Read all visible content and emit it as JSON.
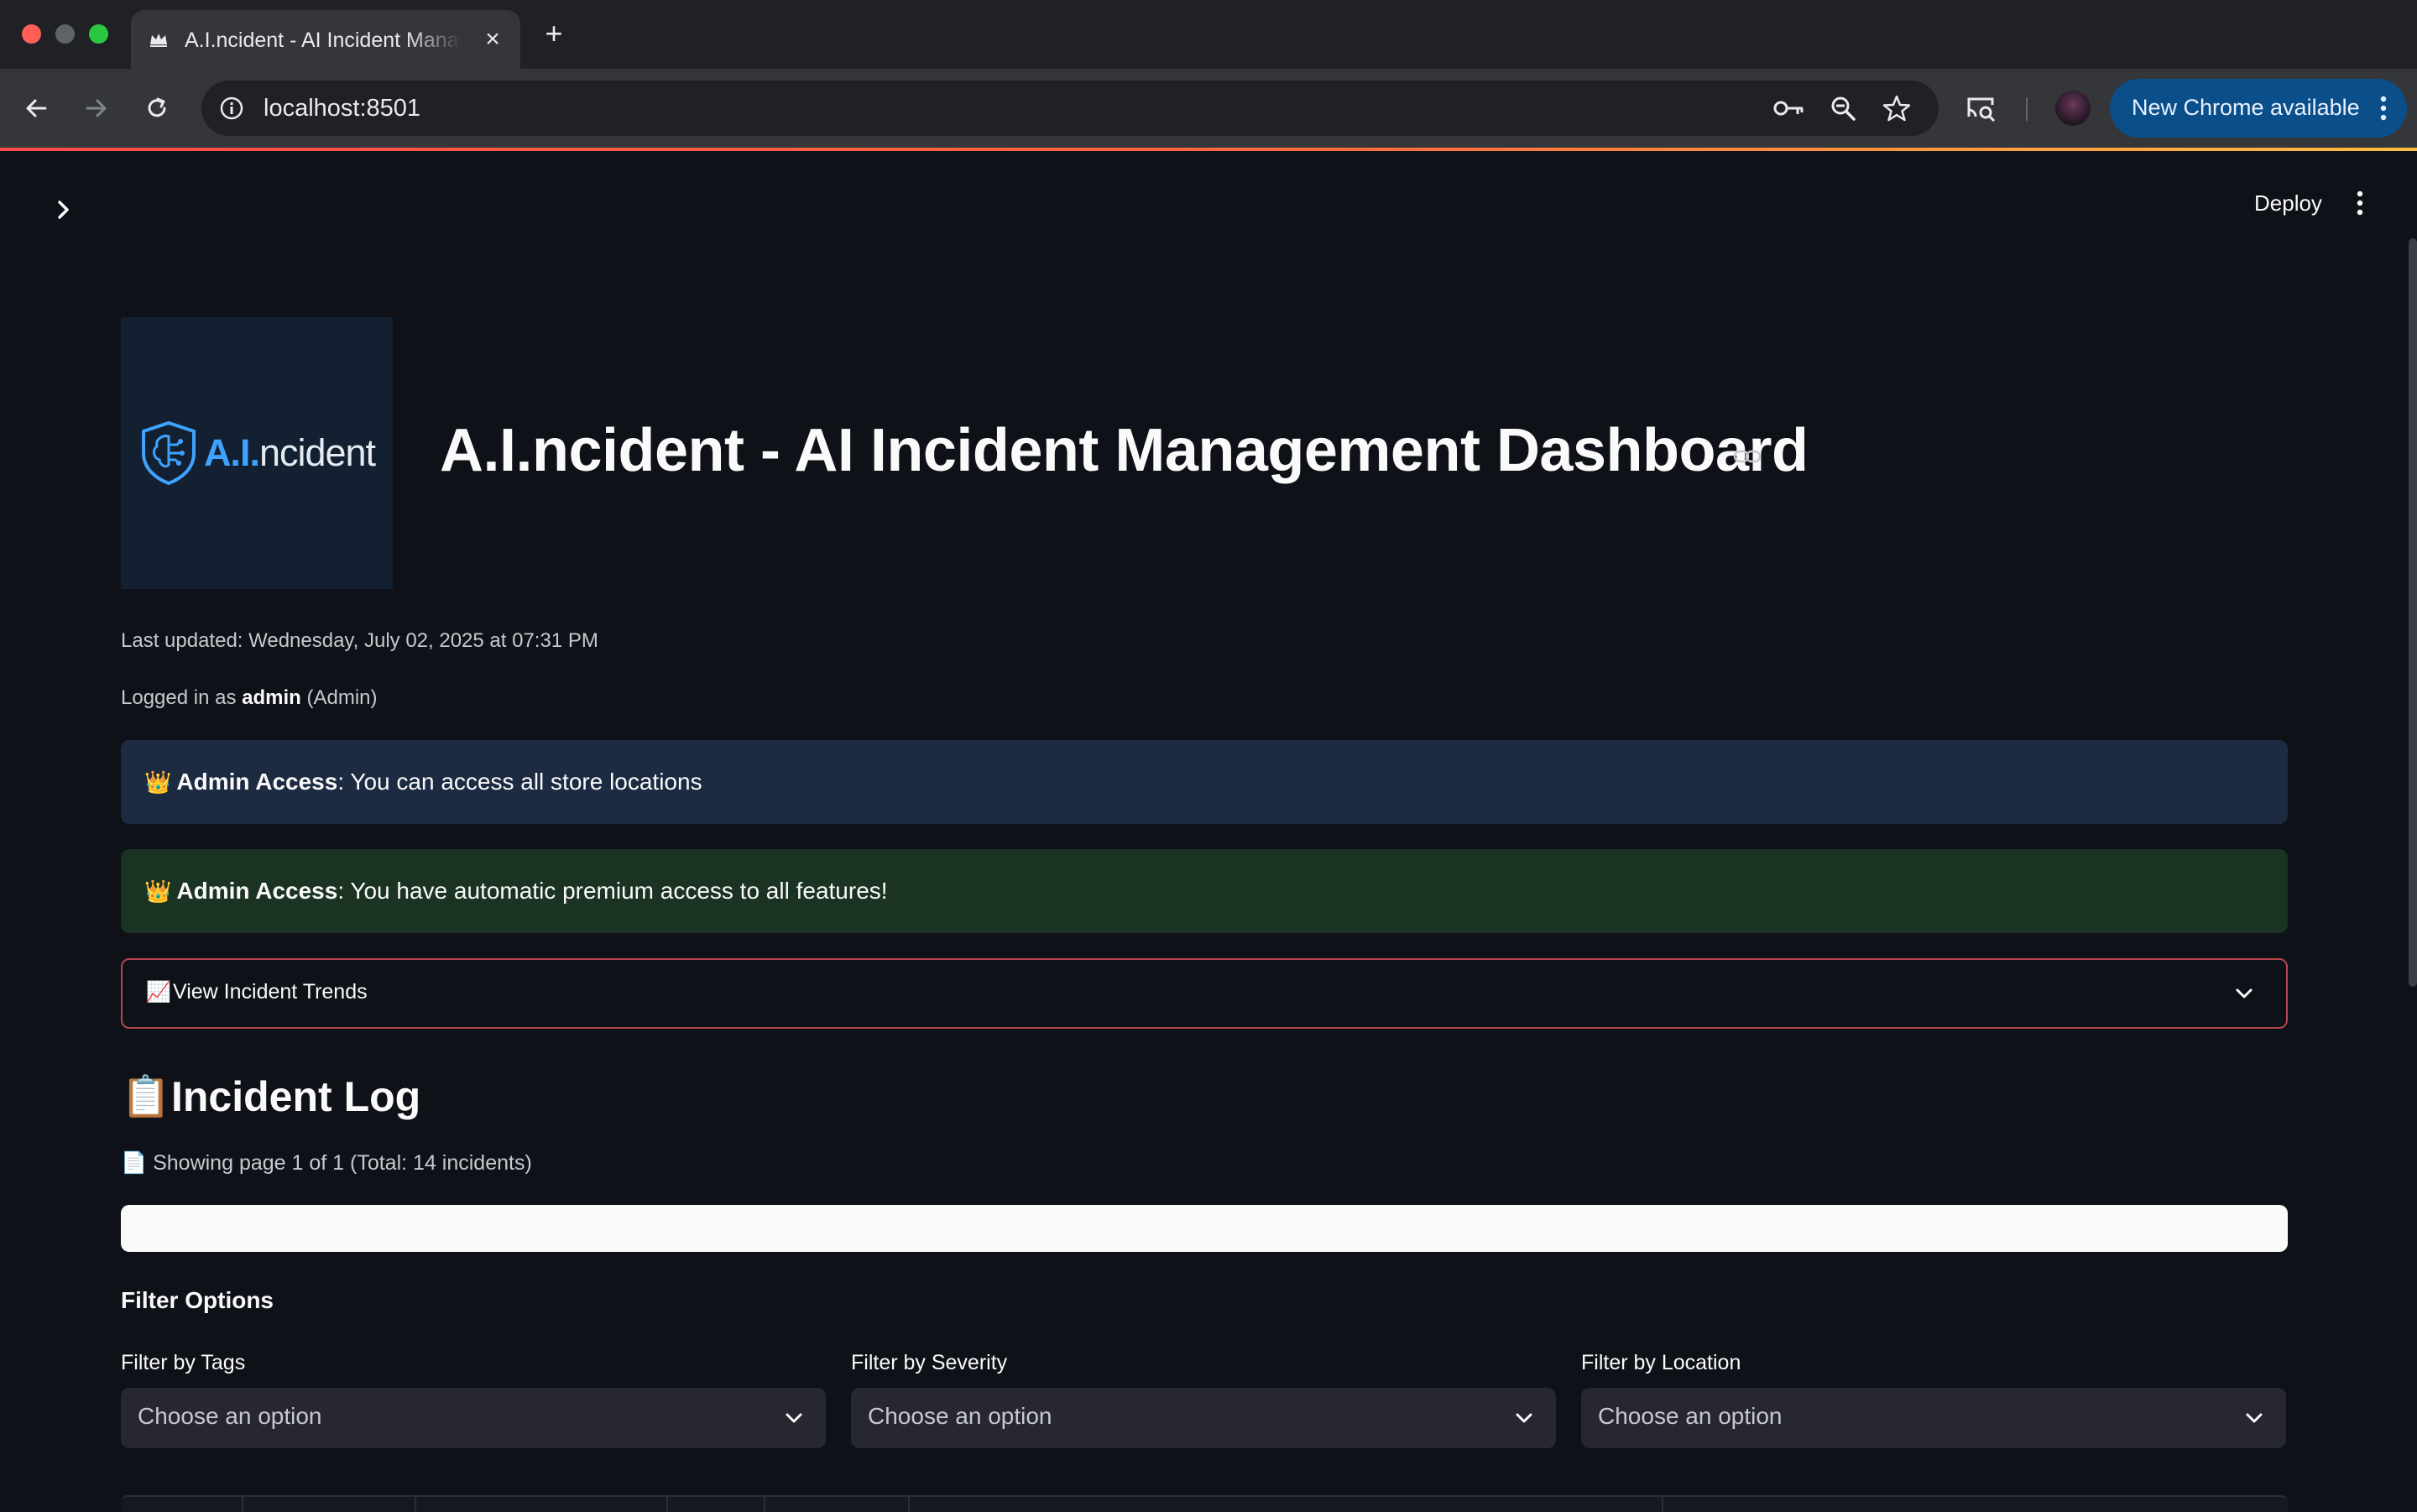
{
  "browser": {
    "tab_title": "A.I.ncident - AI Incident Management Dashboard",
    "tab_close": "×",
    "new_tab": "+",
    "url": "localhost:8501",
    "update_label": "New Chrome available"
  },
  "header": {
    "deploy_label": "Deploy"
  },
  "logo": {
    "prefix": "A.I.",
    "suffix": "ncident"
  },
  "page": {
    "title": "A.I.ncident - AI Incident Management Dashboard",
    "last_updated": "Last updated: Wednesday, July 02, 2025 at 07:31 PM",
    "logged_in_prefix": "Logged in as ",
    "logged_in_user": "admin",
    "logged_in_role": " (Admin)"
  },
  "alerts": {
    "info": {
      "emoji": "👑",
      "title": "Admin Access",
      "text": ": You can access all store locations"
    },
    "success": {
      "emoji": "👑",
      "title": "Admin Access",
      "text": ": You have automatic premium access to all features!"
    }
  },
  "expander": {
    "emoji": "📈",
    "label": "View Incident Trends"
  },
  "incident_log": {
    "emoji": "📋",
    "title": "Incident Log",
    "page_info_emoji": "📄",
    "page_info": "Showing page 1 of 1 (Total: 14 incidents)",
    "search_value": ""
  },
  "filters": {
    "title": "Filter Options",
    "items": [
      {
        "label": "Filter by Tags",
        "placeholder": "Choose an option"
      },
      {
        "label": "Filter by Severity",
        "placeholder": "Choose an option"
      },
      {
        "label": "Filter by Location",
        "placeholder": "Choose an option"
      }
    ]
  },
  "colors": {
    "background": "#0e1117",
    "accent": "#ff4b4b",
    "info_bg": "#1c2a42",
    "success_bg": "#1b3323",
    "chrome_update": "#0b4f8a"
  }
}
